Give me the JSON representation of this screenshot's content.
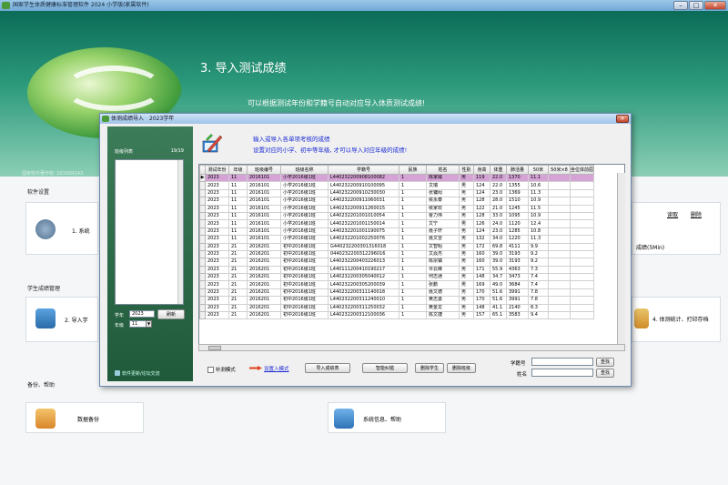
{
  "window": {
    "title": "国家学生体质健康标准管理软件 2024 小学版(家属软件)"
  },
  "banner": {
    "title": "3. 导入测试成绩",
    "subtitle": "可以根据测试年份和学籍号自动对应导入体质测试成绩!",
    "footer": "国家软件著作权: 2016SR243"
  },
  "sections": {
    "settings": "软件设置",
    "settings_item": "1. 系统",
    "scores": "学生成绩管理",
    "scores_item": "2. 导入学",
    "stats_item": "4. 体测统计、打印存档",
    "backup": "备份、帮助",
    "backup_item": "数据备份",
    "sysinfo_item": "系统信息、帮助",
    "right_link1": "读取",
    "right_link2": "删除",
    "right_note": "成绩(5Min)"
  },
  "dialog": {
    "title": "体测成绩导入　2023学年",
    "hint1": "输入或导入各单项考核的成绩",
    "hint2": "设置对应的小学、初中等年级, 才可以导入对应年级的成绩!",
    "class_list_label": "班级列表",
    "class_list_count": "19/19",
    "year_label": "学年",
    "year_value": "2023",
    "refresh_button": "刷新",
    "grade_label": "年级",
    "grade_value": "11",
    "update_link": "软件更新/论坛交流",
    "supplement_label": "补测模式",
    "import_mode_link": "设置入模式",
    "import_scores_button": "导入成绩表",
    "smart_fix_button": "智能纠错",
    "delete_student_button": "删除学生",
    "delete_class_button": "删除班级",
    "student_id_label": "学籍号",
    "name_label": "姓名",
    "search_button_1": "查找",
    "search_button_2": "查找"
  },
  "grid": {
    "columns": [
      "测试年份",
      "年级",
      "班级编号",
      "班级名称",
      "学籍号",
      "民族",
      "姓名",
      "性别",
      "身高",
      "体重",
      "肺活量",
      "50米",
      "50米×8",
      "坐位体前屈"
    ],
    "rows": [
      [
        "2023",
        "11",
        "2016101",
        "小学2016级1班",
        "L440232200908100082",
        "1",
        "陈家威",
        "男",
        "119",
        "22.0",
        "1370",
        "11.1"
      ],
      [
        "2023",
        "11",
        "2016101",
        "小学2016级1班",
        "L440232200910100095",
        "1",
        "文瑞",
        "男",
        "124",
        "22.0",
        "1355",
        "10.6"
      ],
      [
        "2023",
        "11",
        "2016101",
        "小学2016级1班",
        "L440232200910230030",
        "1",
        "张镛闳",
        "男",
        "124",
        "23.0",
        "1369",
        "11.3"
      ],
      [
        "2023",
        "11",
        "2016101",
        "小学2016级1班",
        "L440232200911060031",
        "1",
        "侯永泰",
        "男",
        "128",
        "28.0",
        "1510",
        "10.9"
      ],
      [
        "2023",
        "11",
        "2016101",
        "小学2016级1班",
        "L440232200911260015",
        "1",
        "侯家欢",
        "男",
        "122",
        "21.0",
        "1245",
        "11.5"
      ],
      [
        "2023",
        "11",
        "2016101",
        "小学2016级1班",
        "L440232201001010054",
        "1",
        "曹力伟",
        "男",
        "128",
        "33.0",
        "1095",
        "10.9"
      ],
      [
        "2023",
        "11",
        "2016101",
        "小学2016级1班",
        "L440232201001150014",
        "1",
        "文宁",
        "男",
        "126",
        "24.0",
        "1120",
        "12.4"
      ],
      [
        "2023",
        "11",
        "2016101",
        "小学2016级1班",
        "L440232201001190075",
        "1",
        "聂子轩",
        "男",
        "124",
        "23.0",
        "1285",
        "10.8"
      ],
      [
        "2023",
        "11",
        "2016101",
        "小学2016级1班",
        "L440232201002250076",
        "1",
        "聂文曾",
        "男",
        "132",
        "34.0",
        "1220",
        "11.3"
      ],
      [
        "2023",
        "21",
        "2016201",
        "初中2016级1班",
        "G440232200301316018",
        "1",
        "文智昭",
        "男",
        "172",
        "69.8",
        "4111",
        "9.9"
      ],
      [
        "2023",
        "21",
        "2016201",
        "初中2016级1班",
        "0440232200312296016",
        "1",
        "文焱杰",
        "男",
        "160",
        "39.0",
        "3193",
        "9.2"
      ],
      [
        "2023",
        "21",
        "2016201",
        "初中2016级1班",
        "L440232200403226013",
        "1",
        "陈宗镇",
        "男",
        "160",
        "39.0",
        "3193",
        "9.2"
      ],
      [
        "2023",
        "21",
        "2016201",
        "初中2016级1班",
        "L440111200410190217",
        "1",
        "许云峰",
        "男",
        "171",
        "55.9",
        "4363",
        "7.3"
      ],
      [
        "2023",
        "21",
        "2016201",
        "初中2016级1班",
        "L440232200305040012",
        "1",
        "何志通",
        "男",
        "148",
        "34.7",
        "3473",
        "7.4"
      ],
      [
        "2023",
        "21",
        "2016201",
        "初中2016级1班",
        "L440232200305200039",
        "1",
        "张鹏",
        "男",
        "169",
        "49.0",
        "3684",
        "7.4"
      ],
      [
        "2023",
        "21",
        "2016201",
        "初中2016级1班",
        "L440232200311140018",
        "1",
        "聂文德",
        "男",
        "170",
        "51.6",
        "3991",
        "7.8"
      ],
      [
        "2023",
        "21",
        "2016201",
        "初中2016级1班",
        "L440232200311240010",
        "1",
        "黄志勇",
        "男",
        "170",
        "51.6",
        "3991",
        "7.8"
      ],
      [
        "2023",
        "21",
        "2016201",
        "初中2016级1班",
        "L440232200311250032",
        "1",
        "黄金龙",
        "男",
        "148",
        "41.1",
        "2140",
        "8.3"
      ],
      [
        "2023",
        "21",
        "2016201",
        "初中2016级1班",
        "L440232200312100036",
        "1",
        "陈文捷",
        "男",
        "157",
        "65.1",
        "3583",
        "9.4"
      ]
    ]
  },
  "colors": {
    "selected_row": "#d6a3d6",
    "hint_text": "#1a2bd6",
    "banner_green": "#2d9a7c"
  }
}
